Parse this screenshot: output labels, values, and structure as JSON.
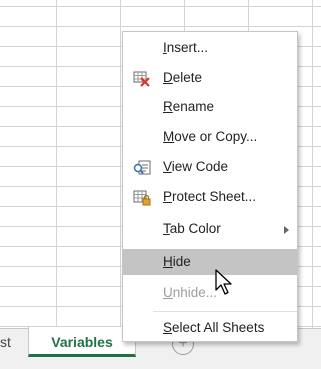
{
  "tabs": {
    "prev_partial": "st",
    "active": "Variables",
    "add_icon": "plus-circle-icon"
  },
  "menu": {
    "items": [
      {
        "id": "insert",
        "label": "Insert...",
        "accel": "I",
        "icon": null,
        "state": "normal"
      },
      {
        "id": "delete",
        "label": "Delete",
        "accel": "D",
        "icon": "delete-sheet-icon",
        "state": "normal"
      },
      {
        "id": "rename",
        "label": "Rename",
        "accel": "R",
        "icon": null,
        "state": "normal"
      },
      {
        "id": "move-copy",
        "label": "Move or Copy...",
        "accel": "M",
        "icon": null,
        "state": "normal"
      },
      {
        "id": "view-code",
        "label": "View Code",
        "accel": "V",
        "icon": "view-code-icon",
        "state": "normal"
      },
      {
        "id": "protect-sheet",
        "label": "Protect Sheet...",
        "accel": "P",
        "icon": "protect-sheet-icon",
        "state": "normal"
      },
      {
        "id": "tab-color",
        "label": "Tab Color",
        "accel": "T",
        "icon": null,
        "state": "normal",
        "submenu": true
      },
      {
        "id": "hide",
        "label": "Hide",
        "accel": "H",
        "icon": null,
        "state": "hover"
      },
      {
        "id": "unhide",
        "label": "Unhide...",
        "accel": "U",
        "icon": null,
        "state": "disabled"
      },
      {
        "id": "select-all",
        "label": "Select All Sheets",
        "accel": "S",
        "icon": null,
        "state": "normal"
      }
    ]
  },
  "colors": {
    "accent": "#217346",
    "hover": "#c4c4c4",
    "disabled": "#9e9e9e"
  }
}
